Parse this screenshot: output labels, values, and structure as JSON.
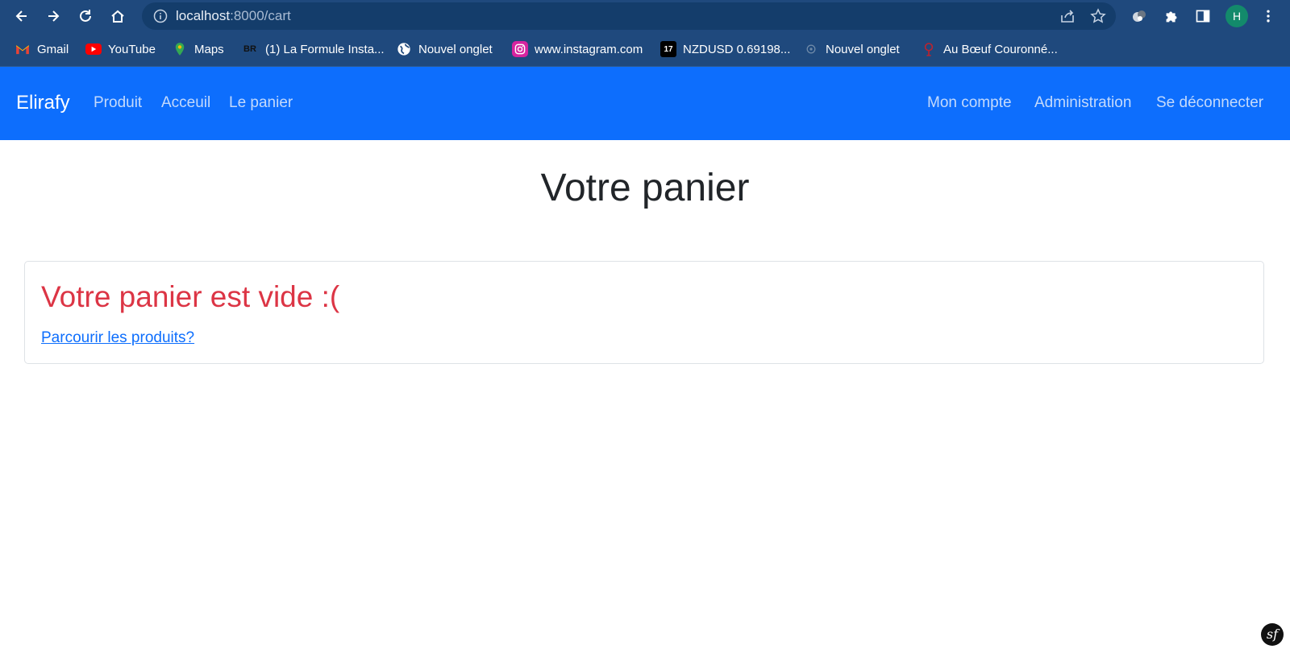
{
  "browser": {
    "url_host": "localhost",
    "url_rest": ":8000/cart",
    "avatar_letter": "H",
    "bookmarks": [
      {
        "label": "Gmail",
        "icon": "gmail-icon"
      },
      {
        "label": "YouTube",
        "icon": "youtube-icon"
      },
      {
        "label": "Maps",
        "icon": "maps-icon"
      },
      {
        "label": "(1) La Formule Insta...",
        "icon": "br-icon",
        "icon_text": "BR"
      },
      {
        "label": "Nouvel onglet",
        "icon": "globe-icon"
      },
      {
        "label": "www.instagram.com",
        "icon": "instagram-icon"
      },
      {
        "label": "NZDUSD 0.69198...",
        "icon": "tradingview-icon",
        "icon_text": "17"
      },
      {
        "label": "Nouvel onglet",
        "icon": "new-tab-icon"
      },
      {
        "label": "Au Bœuf Couronné...",
        "icon": "restaurant-icon"
      }
    ]
  },
  "navbar": {
    "brand": "Elirafy",
    "left_links": [
      "Produit",
      "Acceuil",
      "Le panier"
    ],
    "right_links": [
      "Mon compte",
      "Administration",
      "Se déconnecter"
    ]
  },
  "main": {
    "title": "Votre panier",
    "empty_message": "Votre panier est vide :(",
    "browse_link": "Parcourir les produits?"
  },
  "footer": {
    "logo_text": "sf"
  },
  "colors": {
    "navbar": "#0d6efd",
    "danger": "#dc3545",
    "browser_chrome": "#1f497d"
  }
}
